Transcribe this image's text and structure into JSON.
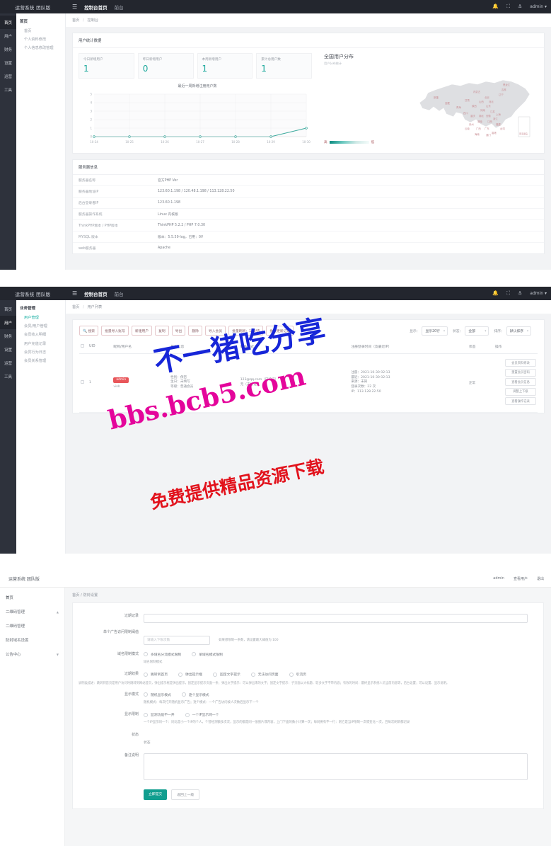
{
  "dashboard": {
    "topbar": {
      "brand": "运营系统 团队版",
      "menu_icon": "hamburger-icon",
      "tabs": [
        {
          "label": "控制台首页",
          "active": true
        },
        {
          "label": "前台",
          "active": false
        }
      ],
      "icons": [
        "bell-icon",
        "fullscreen-icon",
        "tag-icon"
      ],
      "user": "admin ▾"
    },
    "rail": [
      "首页",
      "用户",
      "财务",
      "设置",
      "运营",
      "工具"
    ],
    "subnav": {
      "title": "首页",
      "items": [
        "首页",
        "个人资料修改",
        "个人信息修改管理"
      ]
    },
    "breadcrumb": {
      "root": "首页",
      "current": "控制台"
    },
    "stats_card_title": "用户统计数据",
    "stats": [
      {
        "label": "今日新增用户",
        "value": "1"
      },
      {
        "label": "昨日新增用户",
        "value": "0"
      },
      {
        "label": "本周新增用户",
        "value": "1"
      },
      {
        "label": "累计总用户数",
        "value": "1"
      }
    ],
    "map": {
      "title": "全国用户分布",
      "subtitle": "用户分布统计",
      "legend_high": "高",
      "legend_low": "低",
      "provinces": [
        "新疆",
        "西藏",
        "青海",
        "甘肃",
        "内蒙古",
        "黑龙江",
        "吉林",
        "辽宁",
        "北京",
        "天津",
        "河北",
        "山西",
        "陕西",
        "宁夏",
        "山东",
        "河南",
        "江苏",
        "安徽",
        "上海",
        "浙江",
        "湖北",
        "四川",
        "重庆",
        "湖南",
        "江西",
        "福建",
        "贵州",
        "云南",
        "广西",
        "广东",
        "台湾",
        "海南",
        "香港",
        "澳门",
        "南海诸岛"
      ]
    },
    "chart_data": {
      "type": "line",
      "title": "最近一周新增注册用户数",
      "x": [
        "10-24",
        "10-25",
        "10-26",
        "10-27",
        "10-28",
        "10-29",
        "10-30"
      ],
      "values": [
        0,
        0,
        0,
        0,
        0,
        0,
        1
      ],
      "xlabel": "",
      "ylabel": "",
      "ylim": [
        0,
        5
      ],
      "yticks": [
        "0",
        "1",
        "2",
        "3",
        "4",
        "5"
      ],
      "grid": true,
      "line_color": "#3aa99c"
    },
    "server": {
      "title": "服务器信息",
      "rows": [
        {
          "k": "服务器名称",
          "v": "官方PHP Ver"
        },
        {
          "k": "服务器地址IP",
          "v": "123.60.1.198 / 120.48.1.198 / 113.128.22.50"
        },
        {
          "k": "后台登录者IP",
          "v": "123.60.1.198"
        },
        {
          "k": "服务器操作系统",
          "v": "Linux 内核版"
        },
        {
          "k": "ThinkPHP版本 / PHP版本",
          "v": "ThinkPHP 5.2.2 / PHP 7.0.30"
        },
        {
          "k": "MYSQL 版本",
          "v": "版本：5.5.59-log，已用：0V"
        },
        {
          "k": "web服务器",
          "v": "Apache"
        }
      ]
    }
  },
  "userlist": {
    "topbar": {
      "brand": "运营系统 团队版",
      "tabs": [
        {
          "label": "控制台首页",
          "active": true
        },
        {
          "label": "前台",
          "active": false
        }
      ],
      "user": "admin ▾"
    },
    "rail": [
      "首页",
      "用户",
      "财务",
      "设置",
      "运营",
      "工具"
    ],
    "subnav": {
      "title": "业务管理",
      "items": [
        "用户管理",
        "会员/用户管理",
        "会员收入明细",
        "用户充值记录",
        "会员行为日志",
        "会员关系管理"
      ],
      "active_index": 0
    },
    "breadcrumb": {
      "root": "首页",
      "current": "用户列表"
    },
    "toolbar_buttons": [
      "搜索",
      "批量导入账号",
      "新建用户",
      "复制",
      "导出",
      "删除",
      "导入会员",
      "批量刷新：12345",
      "批量更新记录"
    ],
    "filters": [
      {
        "label": "显示：",
        "value": "显示20行"
      },
      {
        "label": "状态：",
        "value": "全部"
      },
      {
        "label": "排序：",
        "value": "默认排序"
      }
    ],
    "table": {
      "headers": [
        "",
        "UID",
        "昵称/用户名",
        "基本信息",
        "联系方式",
        "注册登录时间（及最近IP）",
        "状态",
        "操作"
      ],
      "rows": [
        {
          "uid": "1",
          "role_badge": "admin",
          "username": "vinb",
          "basic": "性别：保密\n生日：未填写\n等级：普通会员",
          "contact": "123@qq.com（已验证）\n无（未验证）",
          "time": "注册：2021-10-30 02:13\n最近：2021-10-30 02:13\n来源：未知\n登录次数：22 次\nIP：113.128.22.50",
          "status": "正常",
          "actions": [
            "会员资料修改",
            "重置会员密码",
            "查看会员信息",
            "调整上下级",
            "查看操作记录"
          ]
        }
      ]
    }
  },
  "settings": {
    "topbar": {
      "brand": "运营系统 团队版",
      "right": [
        "admin",
        "查看用户",
        "退出"
      ]
    },
    "sidebar": {
      "home": "首页",
      "items": [
        {
          "label": "二维码管理",
          "expanded": true,
          "arrow": "▲"
        },
        {
          "label": "二维码管理",
          "expanded": false,
          "arrow": ""
        },
        {
          "label": "防封域名设置",
          "expanded": false,
          "arrow": ""
        },
        {
          "label": "公告中心",
          "expanded": false,
          "arrow": "▼"
        }
      ]
    },
    "breadcrumb": {
      "root": "首页",
      "current": "防封设置"
    },
    "form": {
      "fields": [
        {
          "label": "过期记录",
          "type": "input",
          "value": "",
          "placeholder": ""
        },
        {
          "label": "单个广告访问限制阈值",
          "type": "input_small",
          "value": "",
          "placeholder": "请输入下限次数",
          "hint": "如果想限制一条数，请设置最大阈值为 100"
        },
        {
          "label": "域名限制模式",
          "type": "radio",
          "options": [
            "多域名分流模式限制",
            "单域名模式限制"
          ],
          "sub_hint": "域名限制模式"
        },
        {
          "label": "过期效果",
          "type": "radio",
          "options": [
            "跳转到首页",
            "弹出提示框",
            "固定文字提示",
            "无法访问页面",
            "引流页"
          ]
        }
      ],
      "paragraph": "说明类描述：跳转到首页是用户访问时跳转到网站首页，弹出提示框是弹出提示，固定显示提示页面一条；弹出文字提示：可以弹出来的文字；固定文字提示：子页面以大标题、较多文字不带内容；有效的时间：最终显示系统人员当前内容等，后台设置；可以设置、显示说明。",
      "display_mode": {
        "label": "显示模式",
        "options": [
          "随机显示模式",
          "逐个显示模式"
        ],
        "hint": "随机模式：每次打开随机显示广告；逐个模式：一个广告访问被人次数后显示下一个"
      },
      "display_limit": {
        "label": "显示限制",
        "options": [
          "监测功能不一开",
          "一个IP显示同一个"
        ],
        "hint": "一个IP显示同一个：同比是小一个IP的个人，个营经测额多次次，显示的都是同一张图片或内容，上门下面的数小计算一次；每同要有不一行：则它是当IP限制一次或变化一次，且每次刷新都记录"
      },
      "static_field": {
        "label": "状态",
        "value": "状态"
      },
      "textarea": {
        "label": "备注说明",
        "value": ""
      },
      "buttons": {
        "primary": "立即提交",
        "secondary": "返回上一级"
      }
    }
  },
  "watermarks": [
    {
      "text": "不一猪吃分享",
      "color": "#1726d8"
    },
    {
      "text": "bbs.bcb5.com",
      "color": "#e4059b"
    },
    {
      "text": "免费提供精品资源下载",
      "color": "#e2121c"
    }
  ]
}
